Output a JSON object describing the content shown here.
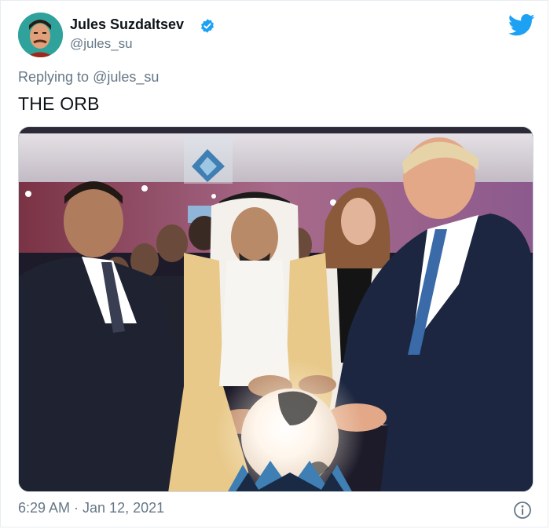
{
  "author": {
    "display_name": "Jules Suzdaltsev",
    "handle": "@jules_su",
    "verified": true
  },
  "reply": {
    "prefix": "Replying to",
    "mention": "@jules_su"
  },
  "tweet": {
    "text": "THE ORB",
    "timestamp": "6:29 AM · Jan 12, 2021"
  },
  "colors": {
    "twitter_blue": "#1da1f2",
    "secondary_text": "#657786"
  },
  "icons": {
    "brand": "twitter-bird-icon",
    "verified": "verified-badge-icon",
    "info": "info-icon"
  }
}
